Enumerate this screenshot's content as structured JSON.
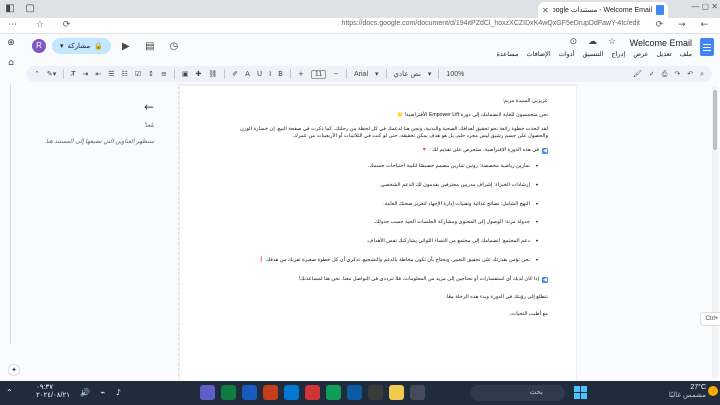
{
  "browser": {
    "tab_title": "Welcome Email - مستندات Google",
    "url": "https://docs.google.com/document/d/194itPZdCl_hoxzXCZIDxK4wQxGF5eDrupDdFawY-4tc/edit"
  },
  "doc": {
    "title": "Welcome Email",
    "menus": [
      "ملف",
      "تعديل",
      "عرض",
      "إدراج",
      "التنسيق",
      "أدوات",
      "الإضافات",
      "مساعدة"
    ],
    "share_label": "مشاركة",
    "avatar_letter": "R"
  },
  "toolbar": {
    "zoom": "100%",
    "style": "نص عادي",
    "font": "Arial",
    "font_size": "11"
  },
  "outline": {
    "title": "مُعدّ",
    "hint": "ستظهر العناوين التي تضيفها إلى المستند هنا."
  },
  "content": {
    "greeting": "عزيزتي السيدة مريم:",
    "intro": "نحن متحمسون للغاية لانضمامك إلى دورة Empower Lift الأفتراضية! 🌟",
    "para1": "لقد اتخذت خطوة رائعة نحو تحقيق أهدافك الصحية والبدنية، ونحن هنا لدعمك في كل لحظة من رحلتك. كما ذكرت في صفحة البيع، إن خسارة الوزن والحصول على جسم رشيق ليس مجرد حلم، بل هو هدف يمكن تحقيقه، حتى لو كنت في الثلاثينات أو الأربعينات من عمرك.",
    "list_heading": "في هذه الدورة الافتراضية، ستحرص على تقديم لك : 🔻",
    "bullets": [
      "تمارين رياضية مخصصة: روتين تمارين مصمم خصيصًا لتلبية احتياجات جسمك.",
      "إرشادات الخبراء: إشراف مدربين محترفين يقدمون لك الدعم الشخصي.",
      "النهج الشامل: نصائح غذائية وتقنيات إدارة الإجهاد لتعزيز صحتك العامة.",
      "جدولة مرنة: الوصول إلى المحتوى ومشاركة الجلسات الحية حسب جدولك.",
      "دعم المجتمع: انضمامك إلى مجتمع من النساء اللواتي يشاركنك نفس الأهداف.",
      "نحن نؤمن بقدرتك على تحقيق التغيير، ونحتاج بأن نكون محاطة بالدعم والتشجيع. تذكري أن كل خطوة صغيرة تقربك من هدفك ❗"
    ],
    "questions": "إذا كان لديك أي استفسارات أو تحتاجين إلى مزيد من المعلومات، فلا تترددي في التواصل معنا. نحن هنا لمساعدتك!",
    "looking_forward": "نتطلع إلى رؤيتك في الدورة وبدء هذه الرحلة معًا.",
    "signoff": "مع أطيب التحيات،"
  },
  "badges": {
    "ctrl": "Ctrl+"
  },
  "taskbar": {
    "search_placeholder": "بحث",
    "time": "٠٩:٣٧",
    "date": "٢٠٢٤/٠٨/٢١",
    "temperature": "27°C",
    "condition": "مشمس غالبًا"
  },
  "colors": {
    "accent": "#1a73e8",
    "share_bg": "#c2e7ff",
    "taskbar_bg": "#202b3c",
    "doc_blue": "#4285f4"
  }
}
